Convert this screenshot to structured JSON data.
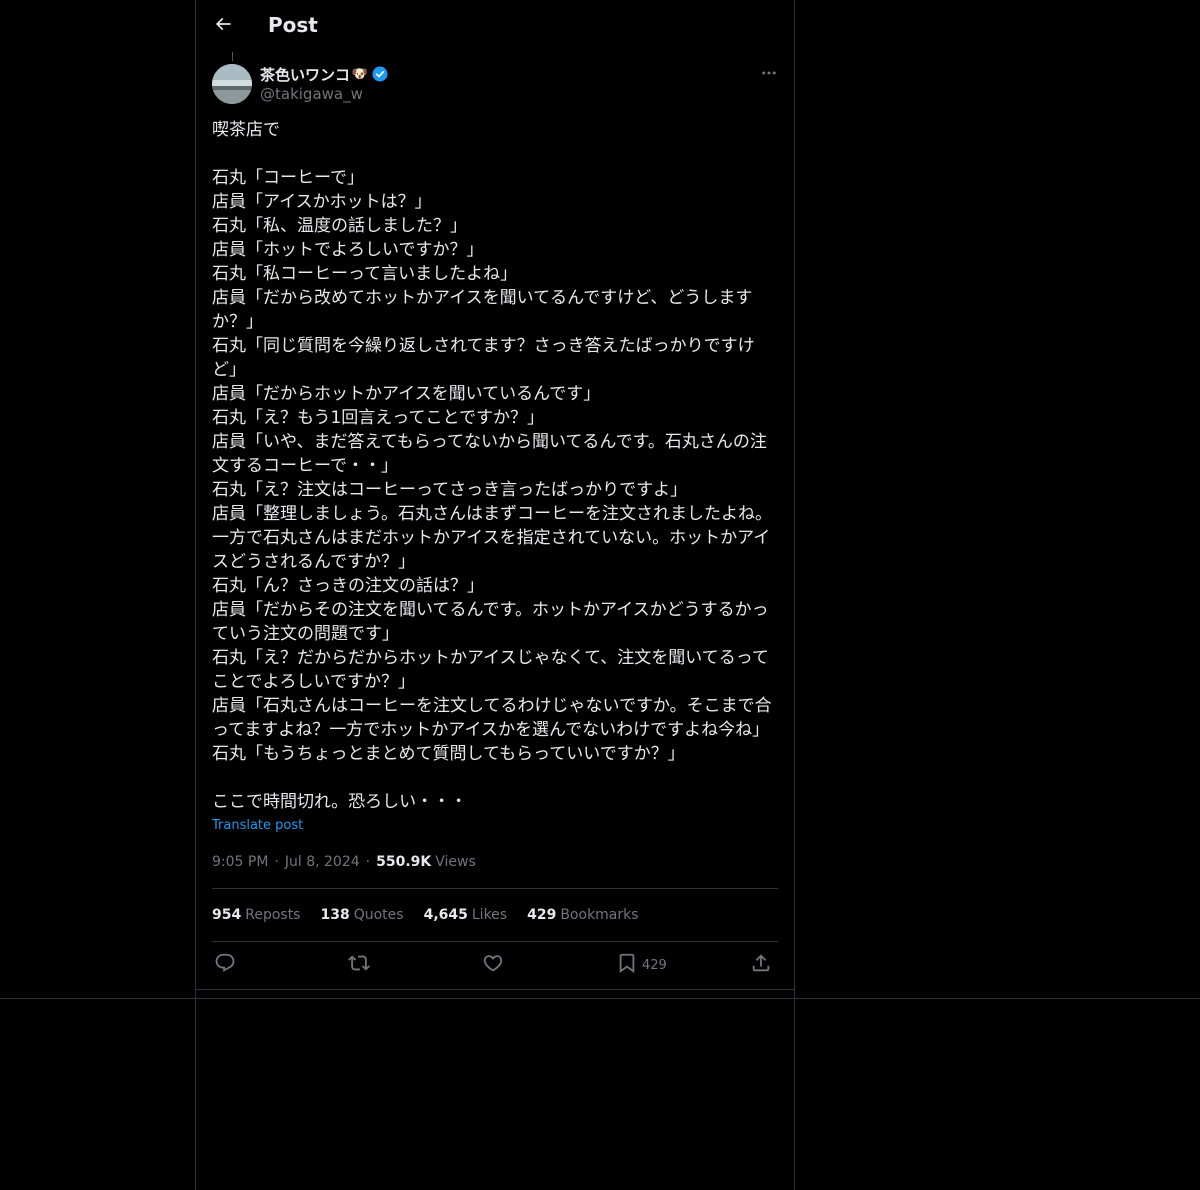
{
  "header": {
    "title": "Post"
  },
  "author": {
    "name": "茶色いワンコ",
    "emoji": "🐶",
    "handle": "@takigawa_w"
  },
  "post": {
    "lines": [
      "喫茶店で",
      "",
      "石丸「コーヒーで」",
      "店員「アイスかホットは？」",
      "石丸「私、温度の話しました？」",
      "店員「ホットでよろしいですか？」",
      "石丸「私コーヒーって言いましたよね」",
      "店員「だから改めてホットかアイスを聞いてるんですけど、どうします",
      "か？」",
      "石丸「同じ質問を今繰り返しされてます？さっき答えたばっかりですけ",
      "ど」",
      "店員「だからホットかアイスを聞いているんです」",
      "石丸「え？もう1回言えってことですか？」",
      "店員「いや、まだ答えてもらってないから聞いてるんです。石丸さんの注",
      "文するコーヒーで・・」",
      "石丸「え？注文はコーヒーってさっき言ったばっかりですよ」",
      "店員「整理しましょう。石丸さんはまずコーヒーを注文されましたよね。",
      "一方で石丸さんはまだホットかアイスを指定されていない。ホットかアイ",
      "スどうされるんですか？」",
      "石丸「ん？さっきの注文の話は？」",
      "店員「だからその注文を聞いてるんです。ホットかアイスかどうするかっ",
      "ていう注文の問題です」",
      "石丸「え？だからだからホットかアイスじゃなくて、注文を聞いてるって",
      "ことでよろしいですか？」",
      "店員「石丸さんはコーヒーを注文してるわけじゃないですか。そこまで合",
      "ってますよね？一方でホットかアイスかを選んでないわけですよね今ね」",
      "石丸「もうちょっとまとめて質問してもらっていいですか？」",
      "",
      "ここで時間切れ。恐ろしい・・・"
    ],
    "translate_label": "Translate post"
  },
  "meta": {
    "time": "9:05 PM",
    "separator": "·",
    "date": "Jul 8, 2024",
    "views_count": "550.9K",
    "views_label": "Views"
  },
  "stats": {
    "reposts": {
      "count": "954",
      "label": "Reposts"
    },
    "quotes": {
      "count": "138",
      "label": "Quotes"
    },
    "likes": {
      "count": "4,645",
      "label": "Likes"
    },
    "bookmarks": {
      "count": "429",
      "label": "Bookmarks"
    }
  },
  "actions": {
    "bookmark_count": "429"
  },
  "colors": {
    "background": "#000000",
    "text": "#e7e9ea",
    "muted": "#71767b",
    "accent": "#1d9bf0",
    "border": "#2f3336"
  }
}
